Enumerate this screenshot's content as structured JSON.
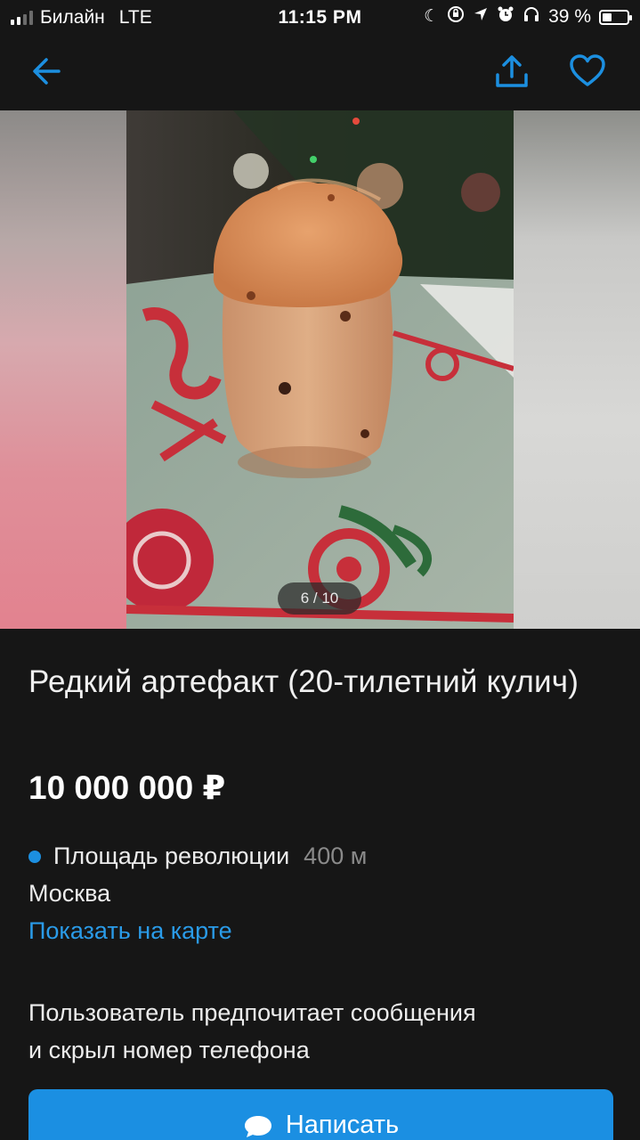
{
  "status_bar": {
    "carrier": "Билайн",
    "network": "LTE",
    "time": "11:15 PM",
    "battery_percent": "39 %",
    "battery_level": 0.39,
    "icons": [
      "moon-icon",
      "orientation-lock-icon",
      "location-icon",
      "alarm-icon",
      "headphones-icon"
    ]
  },
  "nav": {
    "back_icon": "arrow-left-icon",
    "share_icon": "share-icon",
    "favorite_icon": "heart-icon",
    "accent_color": "#1c8fe0"
  },
  "gallery": {
    "counter": "6 / 10"
  },
  "listing": {
    "title": "Редкий артефакт (20-тилетний кулич)",
    "price": "10 000 000 ₽",
    "metro_station": "Площадь революции",
    "metro_distance": "400 м",
    "metro_color": "#1c8fe0",
    "city": "Москва",
    "map_link": "Показать на карте",
    "contact_note_line1": "Пользователь предпочитает сообщения",
    "contact_note_line2": "и скрыл номер телефона",
    "write_button": "Написать",
    "button_color": "#1b8fe2"
  }
}
